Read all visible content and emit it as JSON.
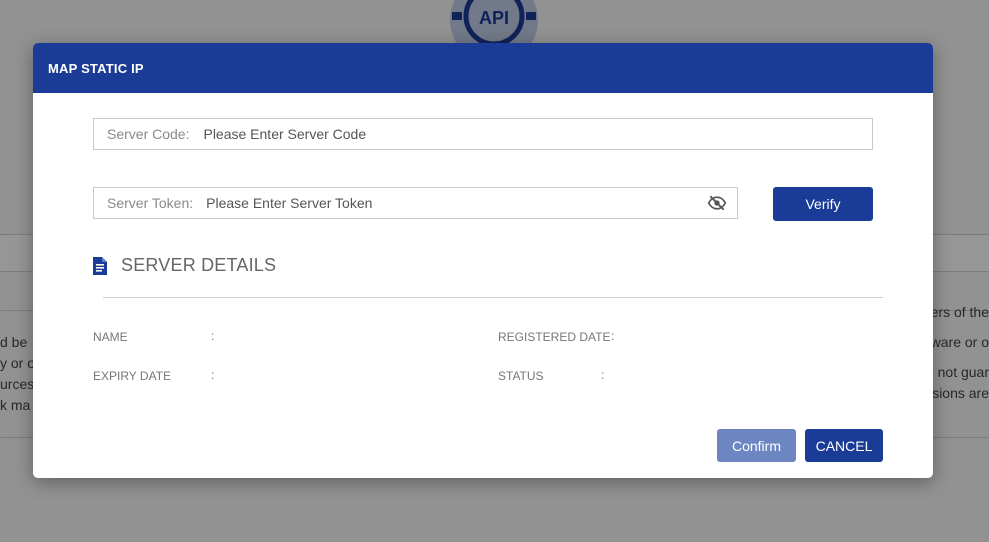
{
  "background": {
    "left_text_fragments": [
      "d be",
      "y or o",
      "urces",
      "k ma"
    ],
    "right_text_fragments": [
      "ers of the",
      "ware or o",
      "s not guar",
      "sions are"
    ]
  },
  "modal": {
    "title": "MAP STATIC IP",
    "server_code": {
      "label": "Server Code:",
      "placeholder": "Please Enter Server Code",
      "value": ""
    },
    "server_token": {
      "label": "Server Token:",
      "placeholder": "Please Enter Server Token",
      "value": ""
    },
    "verify_label": "Verify",
    "section_title": "SERVER DETAILS",
    "details": {
      "name_label": "NAME",
      "registered_date_label": "REGISTERED DATE",
      "expiry_date_label": "EXPIRY DATE",
      "status_label": "STATUS",
      "separator": ":"
    },
    "confirm_label": "Confirm",
    "cancel_label": "CANCEL"
  },
  "icons": {
    "logo": "api-gear-logo",
    "token_visibility": "eye-slash-icon",
    "section": "document-icon"
  },
  "colors": {
    "primary": "#1a3b96",
    "confirm_disabled": "#6d86c2",
    "header_text": "#ffffff"
  }
}
